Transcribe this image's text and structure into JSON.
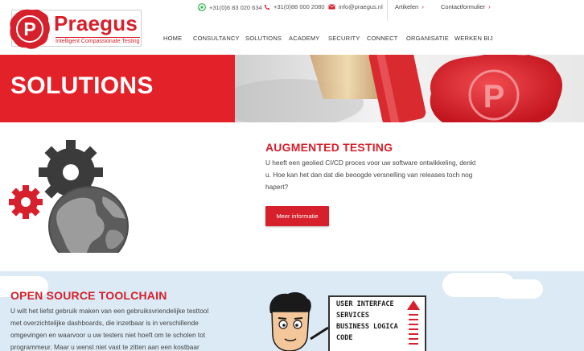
{
  "brand": {
    "name": "Praegus",
    "tagline": "Intelligent Compassionate Testing",
    "seal_letter": "P",
    "primary_color": "#d6202b"
  },
  "topbar": {
    "whatsapp": "+31(0)6 83 020 634",
    "phone": "+31(0)88 000 2080",
    "email": "info@praegus.nl",
    "links": [
      {
        "label": "Artikelen",
        "chevron": "›"
      },
      {
        "label": "Contactformulier",
        "chevron": "›"
      }
    ]
  },
  "nav": [
    "HOME",
    "CONSULTANCY",
    "SOLUTIONS",
    "ACADEMY",
    "SECURITY",
    "CONNECT",
    "ORGANISATIE",
    "WERKEN BIJ"
  ],
  "banner": {
    "title": "SOLUTIONS",
    "color": "#e32129"
  },
  "augmented": {
    "title": "AUGMENTED TESTING",
    "lines": [
      "U heeft een geolied CI/CD proces voor uw software ontwikkeling, denkt",
      "u. Hoe kan het dan dat die beoogde versnelling van releases toch nog",
      "hapert?"
    ],
    "button": "Meer informatie"
  },
  "toolchain": {
    "title": "OPEN SOURCE TOOLCHAIN",
    "lines": [
      "U wilt het liefst gebruik maken van een gebruiksvriendelijke testtool",
      "met overzichtelijke dashboards, die inzetbaar is in verschillende",
      "omgevingen en waarvoor u uw testers niet hoeft om te scholen tot",
      "programmeur. Maar u wenst niet vast te zitten aan een kostbaar"
    ],
    "board_lines": [
      "USER INTERFACE",
      "SERVICES",
      "BUSINESS LOGICA",
      "CODE"
    ],
    "background": "#dbeaf5"
  },
  "icons": {
    "whatsapp": "whatsapp-icon",
    "phone": "phone-icon",
    "email": "email-icon",
    "seal": "wax-seal-icon",
    "globe": "globe-gears-illustration",
    "character": "cartoon-tester-illustration"
  }
}
